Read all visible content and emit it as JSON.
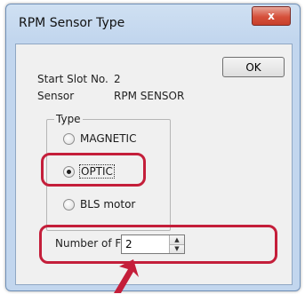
{
  "window": {
    "title": "RPM Sensor Type",
    "close_label": "x"
  },
  "info": {
    "start_slot_label": "Start Slot No.",
    "start_slot_value": "2",
    "sensor_label": "Sensor",
    "sensor_value": "RPM SENSOR"
  },
  "ok_label": "OK",
  "type_group": {
    "title": "Type",
    "options": [
      {
        "label": "MAGNETIC",
        "selected": false
      },
      {
        "label": "OPTIC",
        "selected": true
      },
      {
        "label": "BLS motor",
        "selected": false
      }
    ]
  },
  "fin": {
    "label": "Number of FIN",
    "value": "2"
  },
  "colors": {
    "highlight": "#c41e3a",
    "close_button": "#d6503b"
  },
  "icons": {
    "close": "close-icon",
    "spin_up": "chevron-up-icon",
    "spin_down": "chevron-down-icon",
    "annotation": "arrow-up-icon"
  }
}
